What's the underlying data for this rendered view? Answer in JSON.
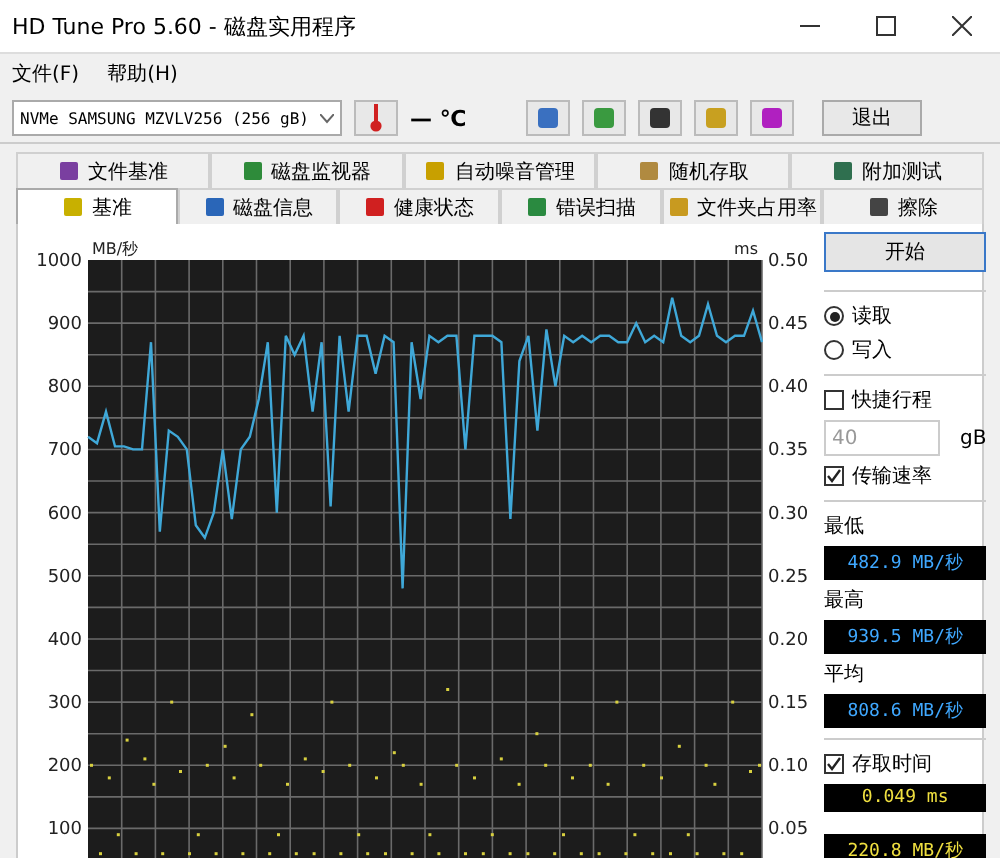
{
  "window": {
    "title": "HD Tune Pro 5.60 - 磁盘实用程序"
  },
  "menu": [
    "文件(F)",
    "帮助(H)"
  ],
  "toolbar": {
    "drive": "NVMe    SAMSUNG MZVLV256 (256 gB)",
    "temperature": "— ℃",
    "exit": "退出"
  },
  "tabs_top": [
    {
      "label": "文件基准",
      "selected": false
    },
    {
      "label": "磁盘监视器",
      "selected": false
    },
    {
      "label": "自动噪音管理",
      "selected": false
    },
    {
      "label": "随机存取",
      "selected": false
    },
    {
      "label": "附加测试",
      "selected": false
    }
  ],
  "tabs_bottom": [
    {
      "label": "基准",
      "selected": true
    },
    {
      "label": "磁盘信息",
      "selected": false
    },
    {
      "label": "健康状态",
      "selected": false
    },
    {
      "label": "错误扫描",
      "selected": false
    },
    {
      "label": "文件夹占用率",
      "selected": false
    },
    {
      "label": "擦除",
      "selected": false
    }
  ],
  "chart": {
    "right_unit": "ms",
    "right_ticks": [
      "0.50",
      "0.45",
      "0.40",
      "0.35",
      "0.30",
      "0.25",
      "0.20",
      "0.15",
      "0.10",
      "0.05"
    ],
    "chart_data": {
      "type": "line",
      "grid": true,
      "ylabel": "MB/秒",
      "ylim": [
        50,
        1000
      ],
      "yticks": [
        100,
        200,
        300,
        400,
        500,
        600,
        700,
        800,
        900,
        1000
      ],
      "series": [
        {
          "color": "#3fa8d8",
          "values": [
            720,
            710,
            760,
            705,
            705,
            700,
            700,
            870,
            570,
            730,
            720,
            700,
            580,
            560,
            600,
            700,
            590,
            700,
            720,
            780,
            870,
            600,
            880,
            850,
            880,
            760,
            870,
            610,
            880,
            760,
            880,
            880,
            820,
            880,
            870,
            480,
            870,
            780,
            880,
            870,
            880,
            880,
            700,
            880,
            880,
            880,
            870,
            590,
            840,
            880,
            730,
            890,
            800,
            880,
            870,
            880,
            870,
            880,
            880,
            870,
            870,
            900,
            870,
            880,
            870,
            940,
            880,
            870,
            880,
            930,
            880,
            870,
            880,
            880,
            920,
            870
          ]
        },
        {
          "type": "scatter",
          "color": "#d8d040",
          "values": [
            200,
            60,
            180,
            90,
            240,
            60,
            210,
            170,
            60,
            300,
            190,
            60,
            90,
            200,
            60,
            230,
            180,
            60,
            280,
            200,
            60,
            90,
            170,
            60,
            210,
            60,
            190,
            300,
            60,
            200,
            90,
            60,
            180,
            60,
            220,
            200,
            60,
            170,
            90,
            60,
            320,
            200,
            60,
            180,
            60,
            90,
            210,
            60,
            170,
            60,
            250,
            200,
            60,
            90,
            180,
            60,
            200,
            60,
            170,
            300,
            60,
            90,
            200,
            60,
            180,
            60,
            230,
            90,
            60,
            200,
            170,
            60,
            300,
            60,
            190,
            200
          ]
        }
      ]
    }
  },
  "panel": {
    "start": "开始",
    "modes": [
      {
        "label": "读取",
        "selected": true
      },
      {
        "label": "写入",
        "selected": false
      }
    ],
    "short_stroke": {
      "label": "快捷行程",
      "checked": false,
      "value": "40",
      "disabled": true,
      "unit": "gB"
    },
    "transfer": {
      "label": "传输速率",
      "checked": true
    },
    "readings": [
      {
        "label": "最低",
        "value": "482.9 MB/秒"
      },
      {
        "label": "最高",
        "value": "939.5 MB/秒"
      },
      {
        "label": "平均",
        "value": "808.6 MB/秒"
      }
    ],
    "access": {
      "label": "存取时间",
      "checked": true,
      "value": "0.049 ms"
    },
    "burst": "220.8 MB/秒"
  }
}
